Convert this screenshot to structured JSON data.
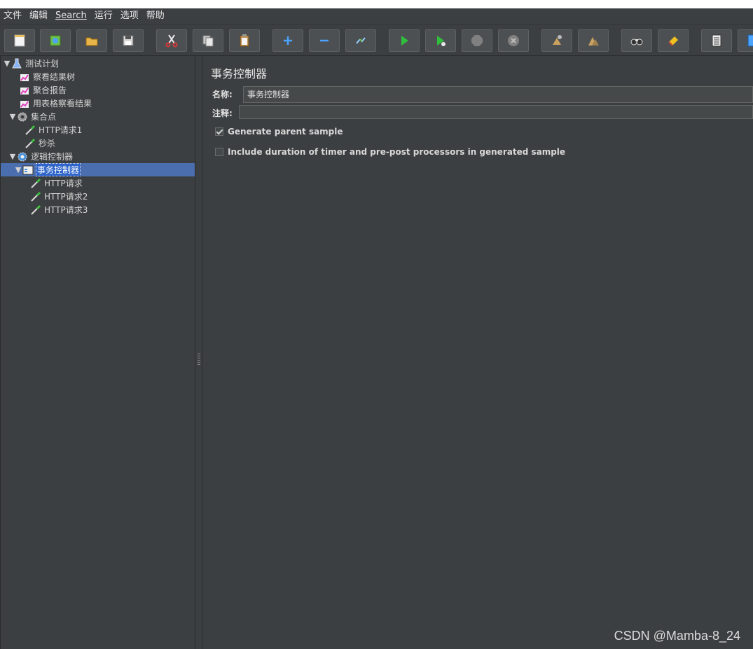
{
  "menubar": {
    "items": [
      "文件",
      "编辑",
      "Search",
      "运行",
      "选项",
      "帮助"
    ]
  },
  "toolbar": {
    "buttons": [
      {
        "icon": "new-file-icon",
        "color": "#f5f5f5"
      },
      {
        "icon": "templates-icon",
        "color": "#6fbf4a"
      },
      {
        "icon": "open-folder-icon",
        "color": "#e8b54a"
      },
      {
        "icon": "save-icon",
        "color": "#d8d8d8"
      },
      {
        "icon": "cut-icon",
        "color": "#d23b3b"
      },
      {
        "icon": "copy-icon",
        "color": "#c8c8c8"
      },
      {
        "icon": "paste-icon",
        "color": "#e0c080"
      },
      {
        "icon": "expand-icon",
        "color": "#4aa3ff"
      },
      {
        "icon": "collapse-icon",
        "color": "#4aa3ff"
      },
      {
        "icon": "toggle-icon",
        "color": "#8fd0ff"
      },
      {
        "icon": "start-icon",
        "color": "#2fbf3c"
      },
      {
        "icon": "start-no-pauses-icon",
        "color": "#2fbf3c"
      },
      {
        "icon": "stop-icon",
        "color": "#808080"
      },
      {
        "icon": "shutdown-icon",
        "color": "#808080"
      },
      {
        "icon": "clear-icon",
        "color": "#c8a060"
      },
      {
        "icon": "clear-all-icon",
        "color": "#c8a060"
      },
      {
        "icon": "search-binoculars-icon",
        "color": "#d0d0d0"
      },
      {
        "icon": "reset-search-icon",
        "color": "#f0c020"
      },
      {
        "icon": "function-helper-icon",
        "color": "#e0e0e0"
      },
      {
        "icon": "help-icon",
        "color": "#4aa3ff"
      }
    ]
  },
  "tree": {
    "nodes": [
      {
        "label": "测试计划",
        "icon": "test-plan-icon",
        "expanded": true
      },
      {
        "label": "察看结果树",
        "icon": "listener-icon"
      },
      {
        "label": "聚合报告",
        "icon": "listener-icon"
      },
      {
        "label": "用表格察看结果",
        "icon": "listener-icon"
      },
      {
        "label": "集合点",
        "icon": "thread-group-icon",
        "expanded": true
      },
      {
        "label": "HTTP请求1",
        "icon": "sampler-icon"
      },
      {
        "label": "秒杀",
        "icon": "sampler-icon"
      },
      {
        "label": "逻辑控制器",
        "icon": "thread-group-icon",
        "expanded": true
      },
      {
        "label": "事务控制器",
        "icon": "transaction-controller-icon",
        "expanded": true,
        "selected": true
      },
      {
        "label": "HTTP请求",
        "icon": "sampler-icon"
      },
      {
        "label": "HTTP请求2",
        "icon": "sampler-icon"
      },
      {
        "label": "HTTP请求3",
        "icon": "sampler-icon"
      }
    ]
  },
  "editor": {
    "title": "事务控制器",
    "name_label": "名称:",
    "name_value": "事务控制器",
    "comment_label": "注释:",
    "comment_value": "",
    "options": [
      {
        "label": "Generate parent sample",
        "checked": true
      },
      {
        "label": "Include duration of timer and pre-post processors in generated sample",
        "checked": false
      }
    ]
  },
  "watermark": "CSDN @Mamba-8_24",
  "colors": {
    "selection": "#4b6eaf",
    "background": "#3c3f41"
  }
}
